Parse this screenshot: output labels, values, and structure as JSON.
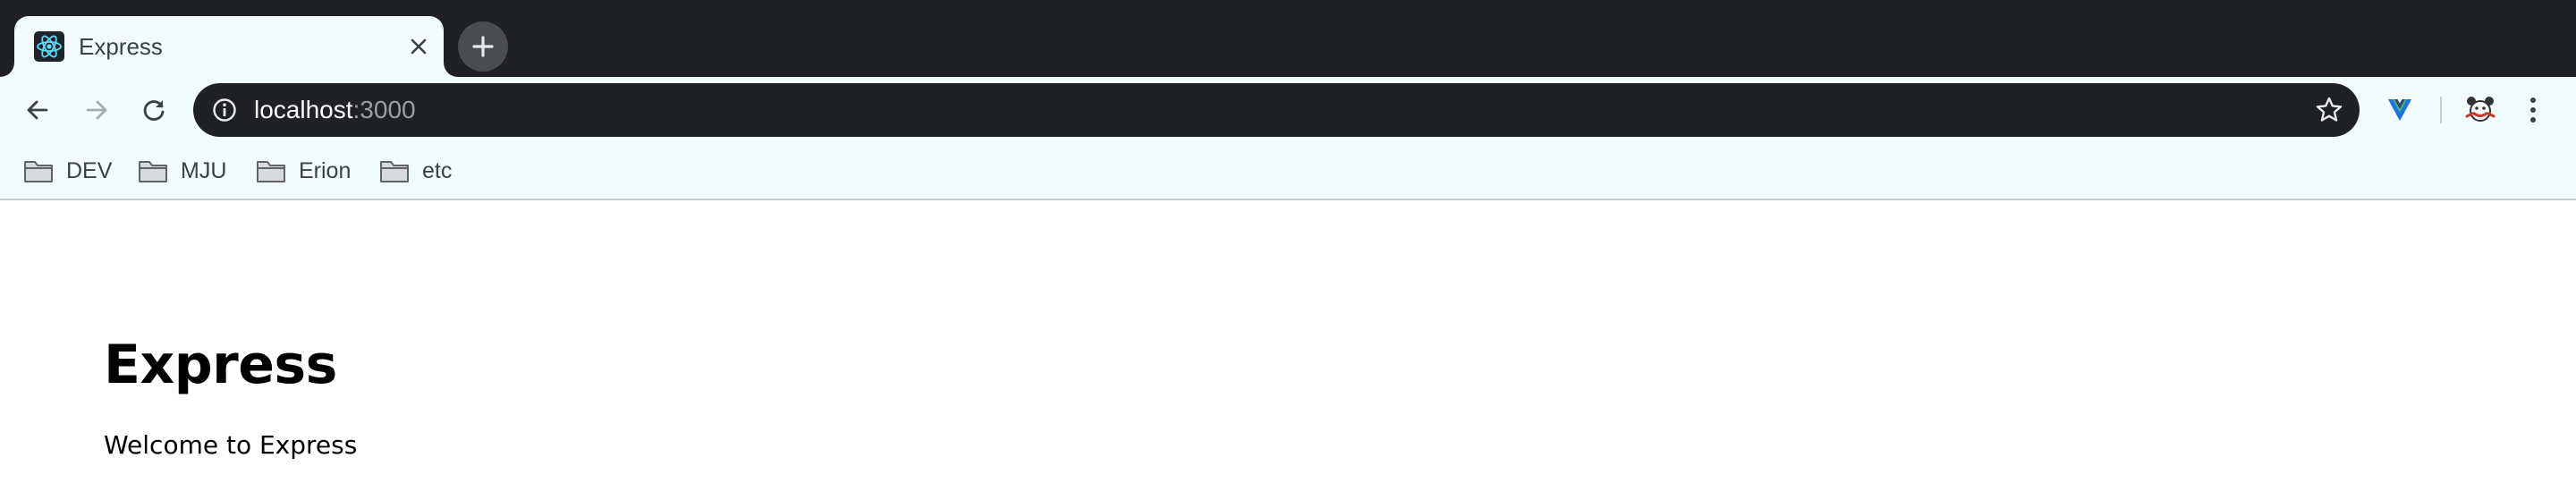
{
  "browser": {
    "tab": {
      "title": "Express",
      "favicon": "react-logo-icon",
      "close": "close-icon"
    },
    "new_tab": "plus-icon",
    "toolbar": {
      "back": "arrow-left-icon",
      "forward": "arrow-right-icon",
      "reload": "reload-icon",
      "url_host": "localhost",
      "url_port": ":3000",
      "site_info": "info-icon",
      "bookmark_star": "star-icon",
      "extensions": [
        "vue-devtools-icon",
        "profile-avatar-icon"
      ],
      "menu": "more-vertical-icon"
    },
    "bookmarks": [
      {
        "label": "DEV",
        "icon": "folder-icon"
      },
      {
        "label": "MJU",
        "icon": "folder-icon"
      },
      {
        "label": "Erion",
        "icon": "folder-icon"
      },
      {
        "label": "etc",
        "icon": "folder-icon"
      }
    ]
  },
  "page": {
    "title": "Express",
    "text": "Welcome to Express"
  },
  "colors": {
    "tabstrip_bg": "#202124",
    "toolbar_bg": "#f2fbfd",
    "omnibox_bg": "#202124",
    "react_blue": "#61dafb"
  }
}
